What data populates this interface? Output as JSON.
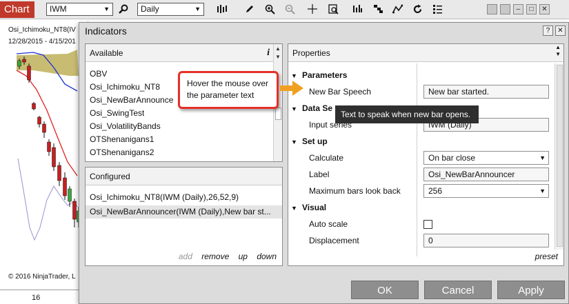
{
  "toolbar": {
    "chart_label": "Chart",
    "instrument_value": "IWM",
    "period_value": "Daily"
  },
  "chart": {
    "title": "Osi_Ichimoku_NT8(IV",
    "date_range": "12/28/2015 - 4/15/201",
    "copyright": "© 2016 NinjaTrader, L",
    "axis_label": "16",
    "colors": {
      "cloud": "#c8bc72",
      "tenkan": "#1f2fcc",
      "kijun": "#e02020",
      "chikou": "#9b8fd0",
      "down_candle": "#c62020",
      "up_candle": "#3fa53f"
    }
  },
  "dialog": {
    "title": "Indicators",
    "help_label": "?",
    "close_label": "✕",
    "available": {
      "header": "Available",
      "info_label": "i",
      "items": [
        "OBV",
        "Osi_Ichimoku_NT8",
        "Osi_NewBarAnnounce",
        "Osi_SwingTest",
        "Osi_VolatilityBands",
        "OTShenanigans1",
        "OTShenanigans2"
      ]
    },
    "configured": {
      "header": "Configured",
      "items": [
        "Osi_Ichimoku_NT8(IWM (Daily),26,52,9)",
        "Osi_NewBarAnnouncer(IWM (Daily),New bar st..."
      ],
      "links": {
        "add": "add",
        "remove": "remove",
        "up": "up",
        "down": "down"
      }
    },
    "properties": {
      "header": "Properties",
      "categories": {
        "parameters": "Parameters",
        "data_series": "Data Se",
        "setup": "Set up",
        "visual": "Visual"
      },
      "rows": {
        "new_bar_speech": {
          "label": "New Bar Speech",
          "value": "New bar started."
        },
        "input_series": {
          "label": "Input series",
          "value": "IWM (Daily)"
        },
        "calculate": {
          "label": "Calculate",
          "value": "On bar close"
        },
        "label": {
          "label": "Label",
          "value": "Osi_NewBarAnnouncer"
        },
        "max_bars": {
          "label": "Maximum bars look back",
          "value": "256"
        },
        "auto_scale": {
          "label": "Auto scale",
          "checked": false
        },
        "displacement": {
          "label": "Displacement",
          "value": "0"
        }
      },
      "preset_label": "preset"
    },
    "buttons": {
      "ok": "OK",
      "cancel": "Cancel",
      "apply": "Apply"
    }
  },
  "callout": {
    "text": "Hover the mouse over the parameter text",
    "border_color": "#e53027",
    "arrow_color": "#f0a020"
  },
  "tooltip": {
    "text": "Text to speak when new bar opens."
  }
}
